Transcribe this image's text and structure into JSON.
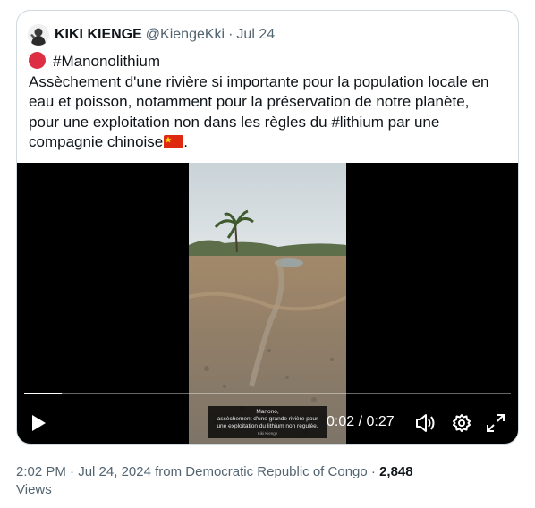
{
  "quoted_tweet": {
    "display_name": "KIKI KIENGE",
    "handle": "@KiengeKki",
    "separator": "·",
    "date": "Jul 24",
    "hashtag_line": "#Manonolithium",
    "text_lines": [
      "Assèchement d'une rivière si importante pour la population locale en",
      "eau et poisson, notamment pour la préservation de notre planète,",
      "pour une exploitation non dans les règles du #lithium par une",
      "compagnie chinoise"
    ],
    "text_end": ".",
    "video": {
      "subtitle_lines": [
        "Manono,",
        "assèchement d'une grande rivière pour",
        "une exploitation du lithium non régulée."
      ],
      "subtitle_credit": "Kiki Kienge",
      "current_time": "0:02",
      "time_separator": " / ",
      "duration": "0:27",
      "progress": 0.078
    }
  },
  "meta": {
    "time": "2:02 PM",
    "dot1": " · ",
    "date": "Jul 24, 2024",
    "source": " from Democratic Republic of Congo",
    "dot2": " · ",
    "views_count": "2,848",
    "views_label": "Views"
  },
  "icons": [
    "avatar",
    "red-circle-icon",
    "china-flag-icon",
    "play-icon",
    "volume-icon",
    "settings-icon",
    "fullscreen-icon"
  ],
  "colors": {
    "text": "#0f1419",
    "secondary": "#536471",
    "border": "#cfd9de",
    "video_bg": "#000000"
  }
}
